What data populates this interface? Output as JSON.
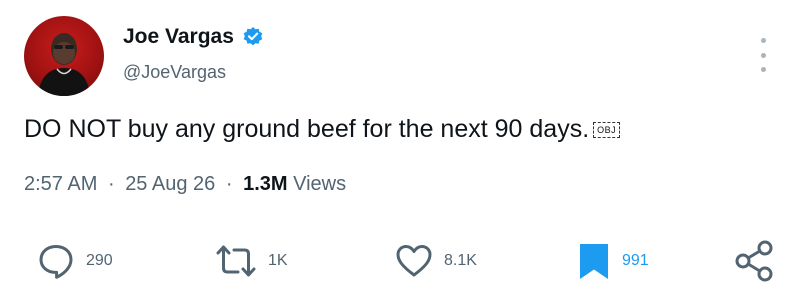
{
  "author": {
    "display_name": "Joe Vargas",
    "handle": "@JoeVargas",
    "verified": true,
    "verified_color": "#1d9bf0",
    "avatar_bg": "#b3171a"
  },
  "tweet": {
    "text": "DO NOT buy any ground beef for the next 90 days.",
    "obj_marker": "OBJ"
  },
  "meta": {
    "time": "2:57 AM",
    "separator": "·",
    "date": "25 Aug 26",
    "views_count": "1.3M",
    "views_label": "Views"
  },
  "actions": {
    "replies": "290",
    "retweets": "1K",
    "likes": "8.1K",
    "bookmarks": "991"
  },
  "icons": {
    "more": "more-vertical-icon",
    "reply": "comment-icon",
    "retweet": "retweet-icon",
    "like": "heart-icon",
    "bookmark": "bookmark-icon",
    "share": "share-icon"
  }
}
